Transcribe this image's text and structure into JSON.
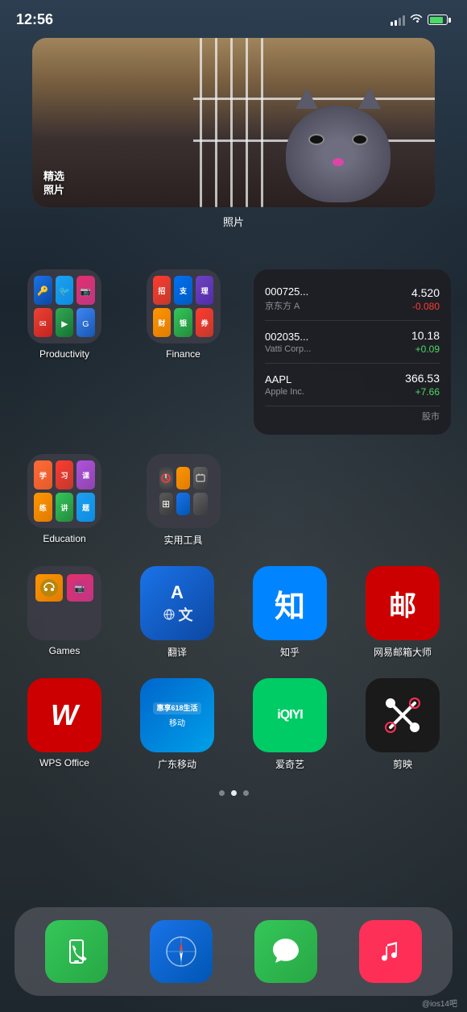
{
  "statusBar": {
    "time": "12:56",
    "signal": "signal",
    "wifi": "wifi",
    "battery": "battery"
  },
  "photoWidget": {
    "overlayText": "精选\n照片",
    "appLabel": "照片"
  },
  "row1": {
    "folder1": {
      "label": "Productivity"
    },
    "folder2": {
      "label": "Finance"
    },
    "stocksWidget": {
      "stocks": [
        {
          "code": "000725...",
          "name": "京东方 A",
          "price": "4.520",
          "change": "-0.080",
          "positive": false
        },
        {
          "code": "002035...",
          "name": "Vatti Corp...",
          "price": "10.18",
          "change": "+0.09",
          "positive": true
        },
        {
          "code": "AAPL",
          "name": "Apple Inc.",
          "price": "366.53",
          "change": "+7.66",
          "positive": true
        }
      ],
      "appLabel": "股市"
    }
  },
  "row2": {
    "folder1": {
      "label": "Education"
    },
    "folder2": {
      "label": "实用工具"
    }
  },
  "row3": {
    "gamesFolder": {
      "label": "Games"
    },
    "translateApp": {
      "label": "翻译",
      "line1": "A",
      "line2": "文"
    },
    "zhihuApp": {
      "label": "知乎",
      "char": "知"
    },
    "emailApp": {
      "label": "网易邮箱大师",
      "char": "邮"
    }
  },
  "row4": {
    "wpsApp": {
      "label": "WPS Office",
      "char": "W"
    },
    "mobileApp": {
      "label": "广东移动",
      "line1": "惠享618生活"
    },
    "iqiyiApp": {
      "label": "爱奇艺",
      "text": "iQIYI"
    },
    "jianyingApp": {
      "label": "剪映",
      "char": "✂"
    }
  },
  "dock": {
    "phone": {
      "label": ""
    },
    "safari": {
      "label": ""
    },
    "messages": {
      "label": ""
    },
    "music": {
      "label": ""
    }
  },
  "watermark": "@ios14吧"
}
